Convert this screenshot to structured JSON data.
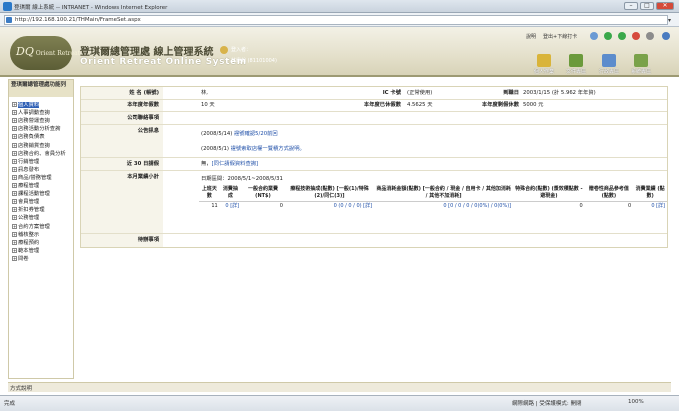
{
  "browser": {
    "title": "登琪爾 線上系統 -- INTRANET - Windows Internet Explorer",
    "url": "http://192.168.100.21/THMain/FrameSet.aspx",
    "status_left": "完成",
    "status_zone": "網際網路 | 受保護模式: 開閉",
    "zoom": "100%"
  },
  "header": {
    "title": "登琪爾總管理處 線上管理系統",
    "subtitle": "Orient Retreat Online System",
    "logo_big": "DQ",
    "logo_small": "Orient Retreat",
    "user_line1": "登入者：",
    "user_line2": "林燈翰 (81101004)",
    "link_help": "說明",
    "link_logout": "登出+下線打卡",
    "icons": [
      {
        "name": "個人作業"
      },
      {
        "name": "文件專區"
      },
      {
        "name": "行政專區"
      },
      {
        "name": "系統專區"
      }
    ]
  },
  "sidebar": {
    "title": "登琪爾總管理處功能列",
    "items": [
      {
        "label": "個人資料"
      },
      {
        "label": "人事調動查詢"
      },
      {
        "label": "店務營運查詢"
      },
      {
        "label": "店務活動分析查詢"
      },
      {
        "label": "店務負債表"
      },
      {
        "label": "店務銷貨查詢"
      },
      {
        "label": "店務合約、會員分析"
      },
      {
        "label": "行銷管理"
      },
      {
        "label": "訊息發布"
      },
      {
        "label": "商品/營務管理"
      },
      {
        "label": "療程管理"
      },
      {
        "label": "課程活動管理"
      },
      {
        "label": "會員管理"
      },
      {
        "label": "折扣券管理"
      },
      {
        "label": "公務管理"
      },
      {
        "label": "合約方案管理"
      },
      {
        "label": "稽核整示"
      },
      {
        "label": "療程預約"
      },
      {
        "label": "範本管理"
      },
      {
        "label": "問卷"
      }
    ]
  },
  "main": {
    "name_label": "姓 名 (帳號)",
    "name_value": "林,",
    "ic_label": "IC 卡號",
    "ic_value": "(正常使用)",
    "report_label": "到職日",
    "report_value": "2003/1/15 (計 5.962 年年資)",
    "annual_label": "本年度年假數",
    "annual_value": "10 天",
    "used_label": "本年度已休假數",
    "used_value": "4.5625 天",
    "remain_label": "本年度剩假休數",
    "remain_value": "5000 元",
    "company_label": "公司聯絡事項",
    "announce_label": "公告訊息",
    "announce_1_prefix": "(2008/5/14)",
    "announce_1_link": "證號確認5/20前回",
    "announce_2_prefix": "(2008/5/1)",
    "announce_2_link": "證號索取店權一覽積方式說明。",
    "recent_label": "近 30 日請假",
    "recent_prefix": "無，",
    "recent_link": "[同仁請假資料查詢]",
    "monthly_label": "本月業績小計",
    "monthly_period": "日期區間：2008/5/1~2008/5/31",
    "stats_headers": [
      "上班天數",
      "消費抽成",
      "一般合約業費 (NT$)",
      "療程技術抽成(點數) [一般(1)/特殊(2)/同仁(3)]",
      "商品消耗金額(點數) [一般合約 / 現金 / 自用卡 / 其他加消耗 / 其他不加消耗]",
      "特殊合約(點數) (漿效積點數 - 避現金)",
      "贈卷性商品參考值 (點數)",
      "消費業績 (點數)"
    ],
    "stats_row": [
      "11",
      "0 [詳]",
      "0",
      "0 (0 / 0 / 0) [詳]",
      "0 [0 / 0 / 0 / 0(0%) / 0(0%)]",
      "0",
      "0",
      "0 [詳]"
    ],
    "review_label": "待辦事項"
  },
  "bottom": {
    "link": "方式說明"
  }
}
